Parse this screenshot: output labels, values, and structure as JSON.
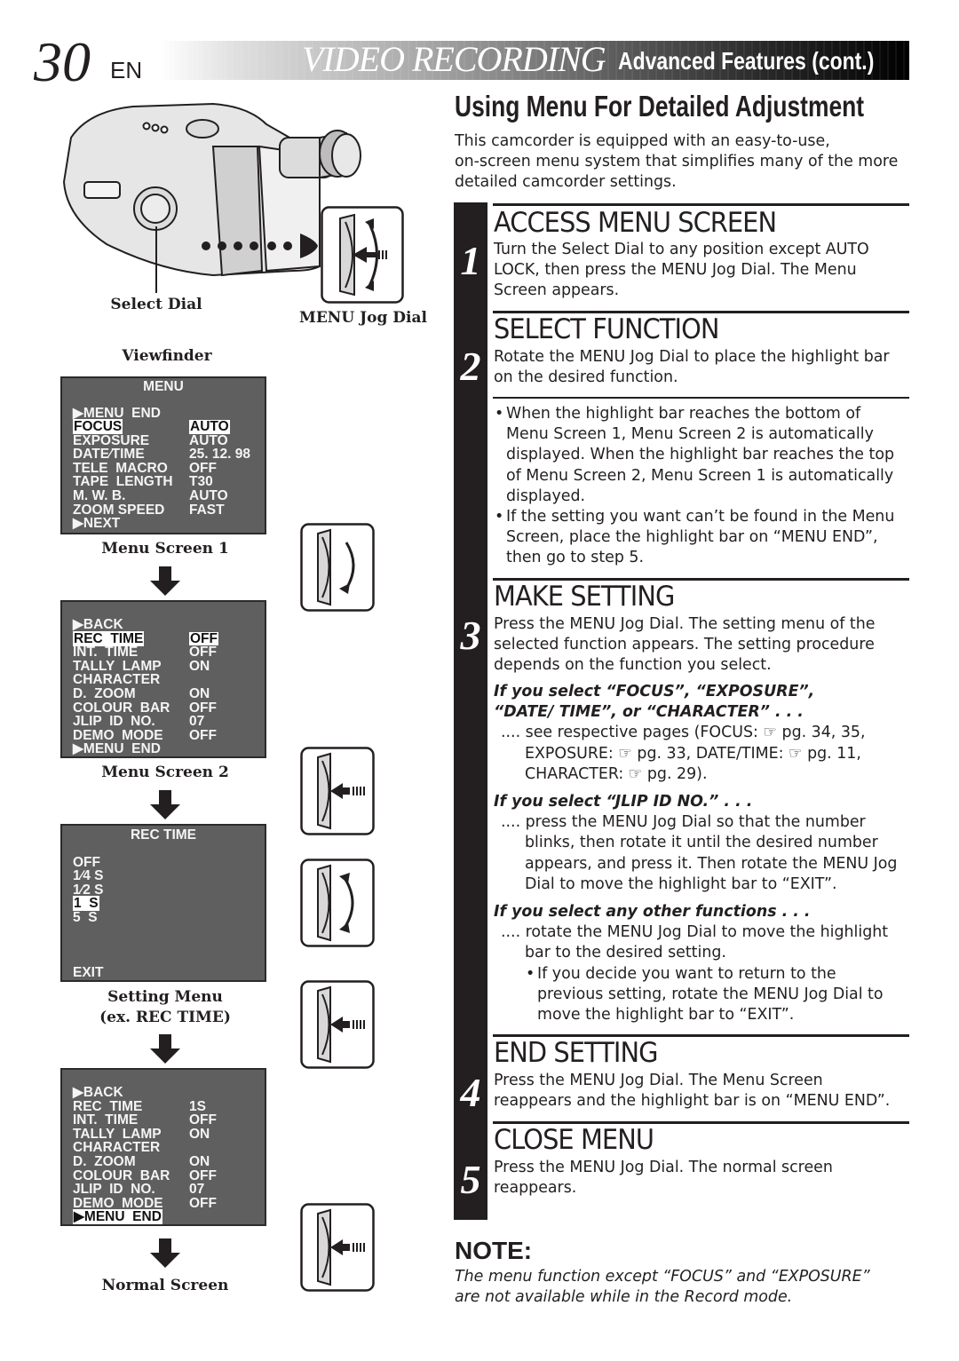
{
  "header": {
    "page_number": "30",
    "language": "EN",
    "title_main": "VIDEO  RECORDING",
    "title_sub": "Advanced Features (cont.)"
  },
  "illustration": {
    "select_dial_label": "Select Dial",
    "menu_jog_dial_label": "MENU Jog Dial",
    "viewfinder_label": "Viewfinder"
  },
  "screens": {
    "menu_screen_1": {
      "title": "MENU",
      "caption": "Menu Screen 1",
      "rows": [
        {
          "label": "▶MENU  END",
          "value": "",
          "highlight": false
        },
        {
          "label": "FOCUS",
          "value": "AUTO",
          "highlight": true,
          "blinking": true
        },
        {
          "label": "EXPOSURE",
          "value": "AUTO",
          "highlight": false
        },
        {
          "label": "DATE∕TIME",
          "value": "25. 12. 98",
          "highlight": false
        },
        {
          "label": "TELE  MACRO",
          "value": "OFF",
          "highlight": false
        },
        {
          "label": "TAPE  LENGTH",
          "value": "T30",
          "highlight": false
        },
        {
          "label": "M. W. B.",
          "value": "AUTO",
          "highlight": false
        },
        {
          "label": "ZOOM SPEED",
          "value": "FAST",
          "highlight": false
        },
        {
          "label": "▶NEXT",
          "value": "",
          "highlight": false
        }
      ]
    },
    "menu_screen_2": {
      "caption": "Menu Screen 2",
      "rows": [
        {
          "label": "▶BACK",
          "value": ""
        },
        {
          "label": "REC  TIME",
          "value": "OFF",
          "highlight": true,
          "blinking": true
        },
        {
          "label": "INT.  TIME",
          "value": "OFF"
        },
        {
          "label": "TALLY  LAMP",
          "value": "ON"
        },
        {
          "label": "CHARACTER",
          "value": ""
        },
        {
          "label": "D.  ZOOM",
          "value": "ON"
        },
        {
          "label": "COLOUR  BAR",
          "value": "OFF"
        },
        {
          "label": "JLIP  ID  NO.",
          "value": "07"
        },
        {
          "label": "DEMO  MODE",
          "value": "OFF"
        },
        {
          "label": "▶MENU  END",
          "value": ""
        }
      ]
    },
    "setting_menu": {
      "title": "REC  TIME",
      "caption_line1": "Setting Menu",
      "caption_line2": "(ex. REC TIME)",
      "options": [
        "OFF",
        "1∕4 S",
        "1∕2 S",
        "1  S",
        "5  S"
      ],
      "selected": "1  S",
      "exit": "EXIT"
    },
    "normal_screen": {
      "caption": "Normal Screen",
      "rows": [
        {
          "label": "▶BACK",
          "value": ""
        },
        {
          "label": "REC  TIME",
          "value": "1S"
        },
        {
          "label": "INT.  TIME",
          "value": "OFF"
        },
        {
          "label": "TALLY  LAMP",
          "value": "ON"
        },
        {
          "label": "CHARACTER",
          "value": ""
        },
        {
          "label": "D.  ZOOM",
          "value": "ON"
        },
        {
          "label": "COLOUR  BAR",
          "value": "OFF"
        },
        {
          "label": "JLIP  ID  NO.",
          "value": "07"
        },
        {
          "label": "DEMO  MODE",
          "value": "OFF"
        },
        {
          "label": "▶MENU  END",
          "value": "",
          "highlight": true
        }
      ]
    }
  },
  "dial_icons": [
    "press",
    "rotate-down",
    "press",
    "rotate-both",
    "press",
    "press"
  ],
  "section": {
    "title": "Using Menu For Detailed Adjustment",
    "intro": [
      "This camcorder is equipped with an easy-to-use,",
      "on-screen menu system that simplifies many of the more",
      "detailed camcorder settings."
    ]
  },
  "steps": [
    {
      "number": "1",
      "heading": "ACCESS MENU SCREEN",
      "lines": [
        "Turn the Select Dial to any position except AUTO",
        "LOCK, then press the MENU Jog Dial. The Menu",
        "Screen appears."
      ]
    },
    {
      "number": "2",
      "heading": "SELECT FUNCTION",
      "lines": [
        "Rotate the MENU Jog Dial to place the highlight bar",
        "on the desired function."
      ],
      "bullets": [
        [
          "When the highlight bar reaches the bottom of",
          "Menu Screen 1, Menu Screen 2 is automatically",
          "displayed. When the highlight bar reaches the top",
          "of Menu Screen 2, Menu Screen 1 is automatically",
          "displayed."
        ],
        [
          "If the setting you want can’t be found in the Menu",
          "Screen, place the highlight bar on “MENU END”,",
          "then go to step 5."
        ]
      ]
    },
    {
      "number": "3",
      "heading": "MAKE SETTING",
      "lines": [
        "Press the MENU Jog Dial. The setting menu of the",
        "selected function appears. The setting procedure",
        "depends on the function you select."
      ],
      "cases": [
        {
          "title": [
            "If you select “FOCUS”, “EXPOSURE”,",
            "“DATE/ TIME”, or “CHARACTER” . . ."
          ],
          "lines": [
            ".... see respective pages (FOCUS: ☞ pg. 34, 35,",
            "EXPOSURE: ☞ pg. 33, DATE/TIME: ☞ pg. 11,",
            "CHARACTER: ☞ pg. 29)."
          ]
        },
        {
          "title": [
            "If you select “JLIP ID NO.” . . ."
          ],
          "lines": [
            ".... press the MENU Jog Dial so that the number",
            "blinks, then rotate it until the desired number",
            "appears, and press it. Then rotate the MENU Jog",
            "Dial to move the highlight bar to “EXIT”."
          ]
        },
        {
          "title": [
            "If you select any other functions . . ."
          ],
          "lines": [
            ".... rotate the MENU Jog Dial to move the highlight",
            "bar to the desired setting."
          ],
          "bullet": [
            "If you decide you want to return to the",
            "previous setting, rotate the MENU Jog Dial to",
            "move the highlight bar to “EXIT”."
          ]
        }
      ]
    },
    {
      "number": "4",
      "heading": "END SETTING",
      "lines": [
        "Press the MENU Jog Dial. The Menu Screen",
        "reappears and the highlight bar is on “MENU END”."
      ]
    },
    {
      "number": "5",
      "heading": "CLOSE MENU",
      "lines": [
        "Press the MENU Jog Dial. The normal screen",
        "reappears."
      ]
    }
  ],
  "note": {
    "heading": "NOTE:",
    "lines": [
      "The menu function except “FOCUS” and “EXPOSURE”",
      "are not available while in the Record mode."
    ]
  }
}
